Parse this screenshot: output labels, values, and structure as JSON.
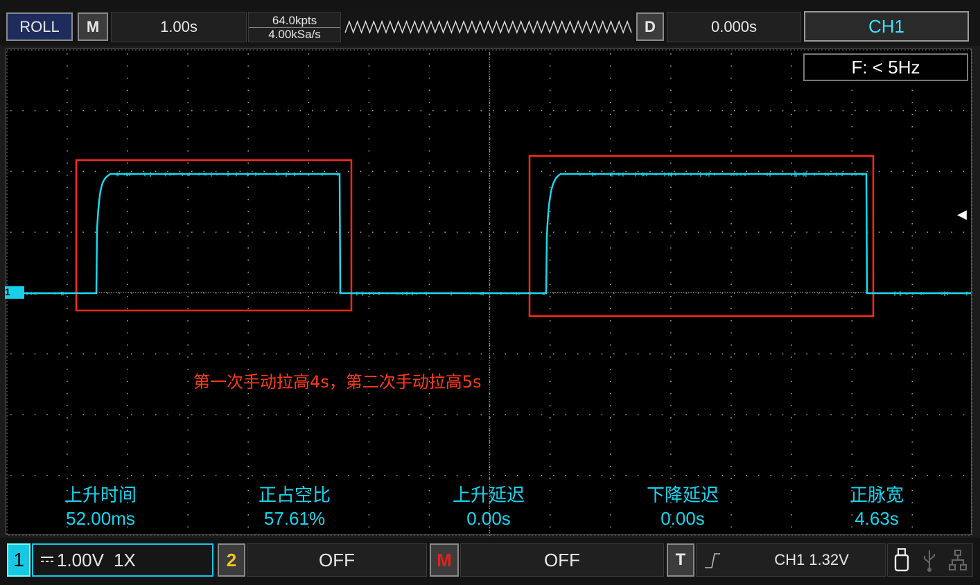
{
  "top_bar": {
    "mode_label": "ROLL",
    "menu_label": "M",
    "timebase": "1.00s",
    "memory_depth": "64.0kpts",
    "sample_rate": "4.00kSa/s",
    "delay_label": "D",
    "delay_value": "0.000s",
    "channel_select": "CH1"
  },
  "screen": {
    "frequency_readout": "F: < 5Hz",
    "channel_marker": "1",
    "annotation": "第一次手动拉高4s，第二次手动拉高5s",
    "measurements": [
      {
        "label": "上升时间",
        "value": "52.00ms"
      },
      {
        "label": "正占空比",
        "value": "57.61%"
      },
      {
        "label": "上升延迟",
        "value": "0.00s"
      },
      {
        "label": "下降延迟",
        "value": "0.00s"
      },
      {
        "label": "正脉宽",
        "value": "4.63s"
      }
    ]
  },
  "bottom_bar": {
    "ch1_number": "1",
    "ch1_coupling_icon": "dc-coupling-icon",
    "ch1_scale": "1.00V",
    "ch1_probe": "1X",
    "ch2_number": "2",
    "ch2_state": "OFF",
    "math_label": "M",
    "math_state": "OFF",
    "trigger_label": "T",
    "trigger_slope_icon": "rising-edge-icon",
    "trigger_info": "CH1 1.32V",
    "status_icons": [
      "usb-drive-icon",
      "usb-icon",
      "network-icon"
    ]
  },
  "colors": {
    "trace": "#18d8ee",
    "annotation": "#ff3a1a",
    "measurement": "#16d6f0",
    "ch2": "#f2c322",
    "math": "#e2231a"
  }
}
